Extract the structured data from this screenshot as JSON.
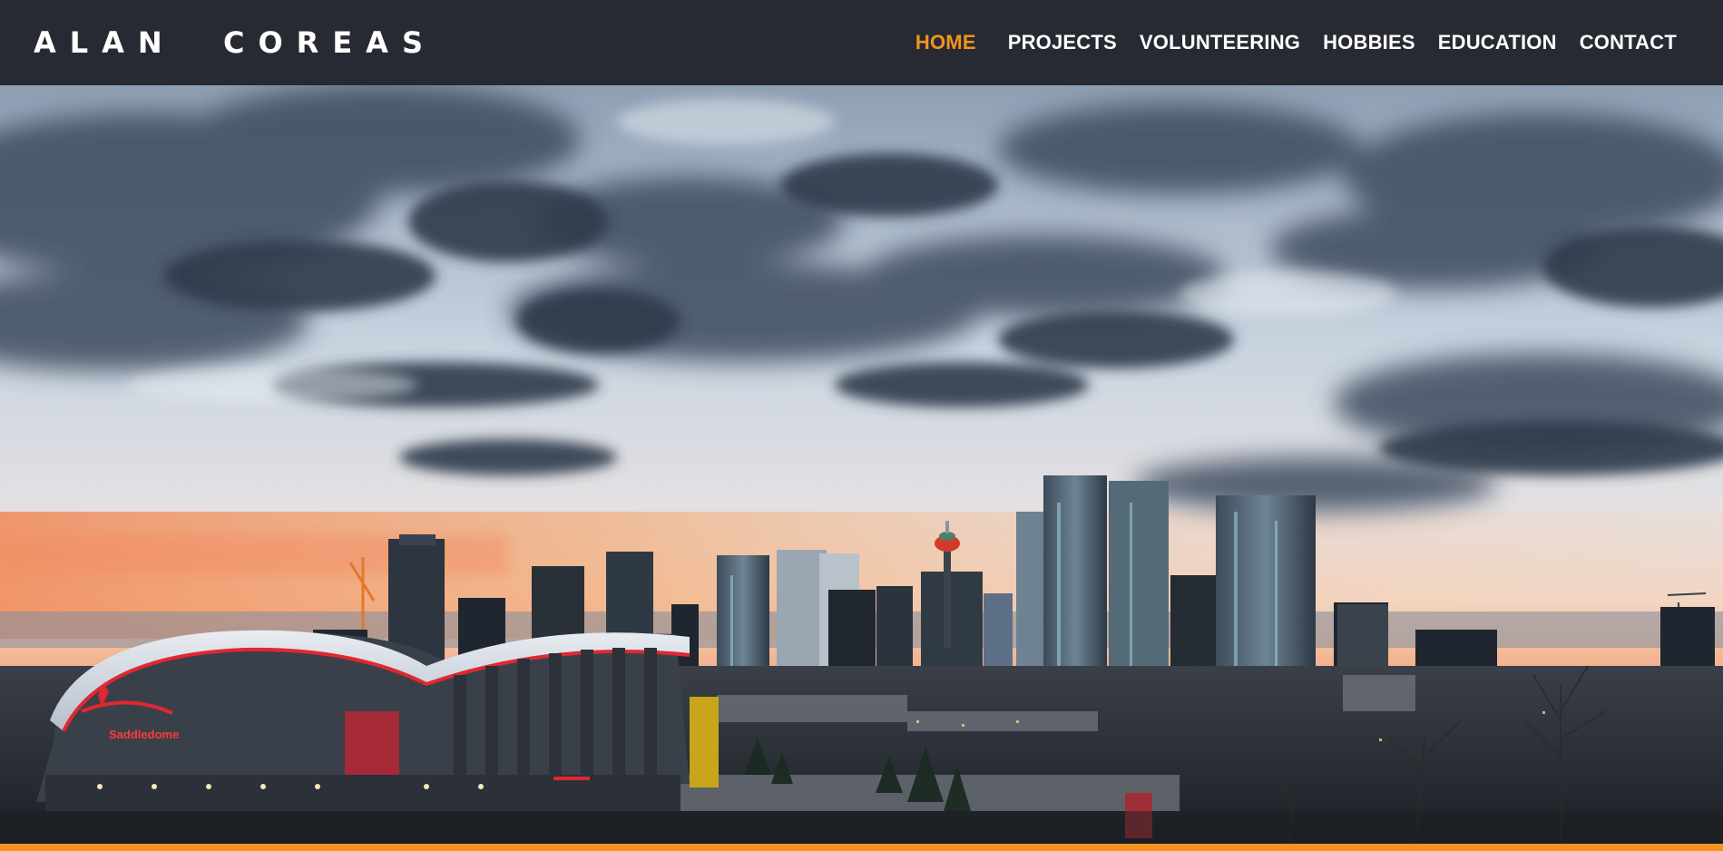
{
  "brand": {
    "name": "ALAN  COREAS"
  },
  "nav": {
    "items": [
      {
        "label": "HOME",
        "active": true
      },
      {
        "label": "PROJECTS",
        "active": false
      },
      {
        "label": "VOLUNTEERING",
        "active": false
      },
      {
        "label": "HOBBIES",
        "active": false
      },
      {
        "label": "EDUCATION",
        "active": false
      },
      {
        "label": "CONTACT",
        "active": false
      }
    ]
  },
  "hero": {
    "arena_sign": "Saddledome"
  },
  "colors": {
    "navbar_bg": "#272a33",
    "accent": "#f3941e",
    "nav_text": "#ffffff"
  }
}
